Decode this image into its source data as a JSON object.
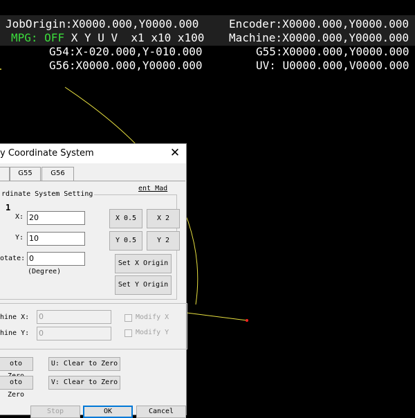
{
  "readout": {
    "job_origin": "JobOrigin:X0000.000,Y0000.000",
    "encoder": "Encoder:X0000.000,Y0000.000",
    "mpg_label": "MPG:",
    "mpg_state": "OFF",
    "mpg_axes": "X Y U V  x1 x10 x100",
    "machine": "Machine:X0000.000,Y0000.000",
    "g54": "G54:X-020.000,Y-010.000",
    "g55": "G55:X0000.000,Y0000.000",
    "g56": "G56:X0000.000,Y0000.000",
    "uv": "UV: U0000.000,V0000.000"
  },
  "colors": {
    "readout_bg": "#202020",
    "mpg_green": "#3cdc3c",
    "path_yellow": "#e8e040",
    "marker_red": "#ff2020"
  },
  "dialog": {
    "title": "y Coordinate System",
    "close_icon": "close-icon",
    "tabs": [
      "",
      "G55",
      "G56"
    ],
    "group_title": "rdinate System Setting",
    "mode_label": "ent Mad",
    "coord_number": "1",
    "x_label": "X:",
    "x_value": "20",
    "y_label": "Y:",
    "y_value": "10",
    "rotate_label": "otate:",
    "rotate_value": "0",
    "degree_label": "(Degree)",
    "btn_x_half": "X 0.5",
    "btn_x_double": "X 2",
    "btn_y_half": "Y 0.5",
    "btn_y_double": "Y 2",
    "btn_set_x": "Set X Origin",
    "btn_set_y": "Set Y Origin",
    "machine_x_label": "hine X:",
    "machine_x_value": "0",
    "machine_y_label": "hine Y:",
    "machine_y_value": "0",
    "modify_x": "Modify X",
    "modify_y": "Modify Y",
    "goto_zero_1": "oto Zero",
    "goto_zero_2": "oto Zero",
    "u_clear": "U: Clear to Zero",
    "v_clear": "V: Clear to Zero",
    "stop": "Stop",
    "ok": "OK",
    "cancel": "Cancel"
  }
}
